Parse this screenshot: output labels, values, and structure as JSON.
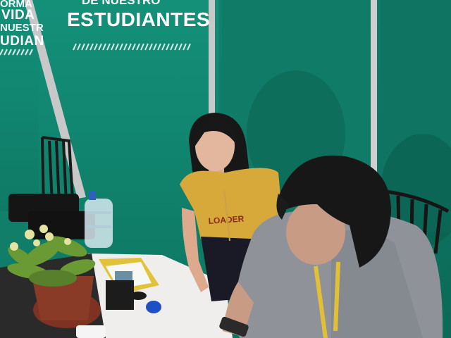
{
  "photo": {
    "description_label": "Two students at an event booth with a green backdrop",
    "banner_left_fragments": [
      "ORMA",
      "VIDA",
      "NUESTR",
      "UDIAN"
    ],
    "banner_main_top_fragment": "DE NUESTRO",
    "banner_main_title": "ESTUDIANTES",
    "shirt_print": "LOADER",
    "colors": {
      "backdrop_green": "#117d68",
      "backdrop_green_dark": "#0a5f50",
      "pole_gray": "#c9c9c9",
      "table_white": "#f1f0ee",
      "mustard_shirt": "#d6a93a",
      "gray_shirt": "#8f9399",
      "hair_black": "#171717",
      "plant_green": "#6a9a33",
      "pot_brown": "#8a3b28"
    }
  }
}
